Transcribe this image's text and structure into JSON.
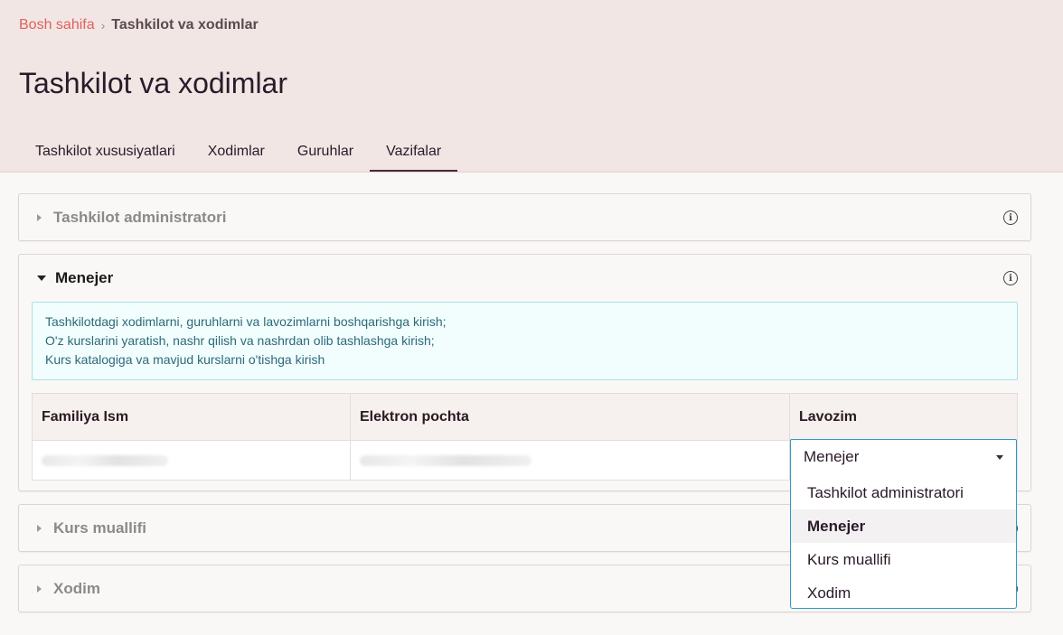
{
  "breadcrumb": {
    "home": "Bosh sahifa",
    "separator": "›",
    "current": "Tashkilot va xodimlar"
  },
  "page_title": "Tashkilot va xodimlar",
  "tabs": [
    {
      "label": "Tashkilot xususiyatlari"
    },
    {
      "label": "Xodimlar"
    },
    {
      "label": "Guruhlar"
    },
    {
      "label": "Vazifalar",
      "active": true
    }
  ],
  "panels": {
    "admin": {
      "title": "Tashkilot administratori"
    },
    "manager": {
      "title": "Menejer",
      "description": [
        "Tashkilotdagi xodimlarni, guruhlarni va lavozimlarni boshqarishga kirish;",
        "O'z kurslarini yaratish, nashr qilish va nashrdan olib tashlashga kirish;",
        "Kurs katalogiga va mavjud kurslarni o'tishga kirish"
      ],
      "table": {
        "headers": [
          "Familiya Ism",
          "Elektron pochta",
          "Lavozim"
        ]
      }
    },
    "author": {
      "title": "Kurs muallifi"
    },
    "employee": {
      "title": "Xodim"
    }
  },
  "role_select": {
    "value": "Menejer",
    "options": [
      "Tashkilot administratori",
      "Menejer",
      "Kurs muallifi",
      "Xodim"
    ]
  },
  "info_glyph": "i",
  "colors": {
    "accent_link": "#e0605c",
    "header_bg": "#f2e6e4",
    "info_box_bg": "#f2fdfd",
    "select_border": "#2a9ac8"
  }
}
